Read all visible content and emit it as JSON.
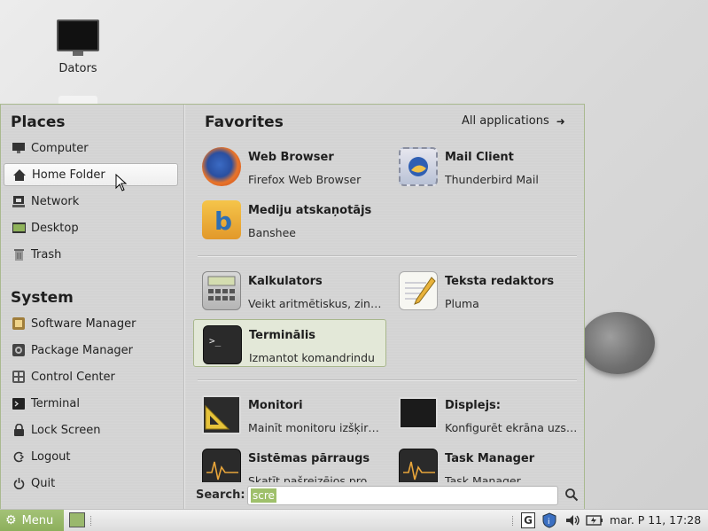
{
  "desktop": {
    "computer_label": "Dators"
  },
  "places": {
    "title": "Places",
    "items": [
      {
        "label": "Computer"
      },
      {
        "label": "Home Folder"
      },
      {
        "label": "Network"
      },
      {
        "label": "Desktop"
      },
      {
        "label": "Trash"
      }
    ]
  },
  "system": {
    "title": "System",
    "items": [
      {
        "label": "Software Manager"
      },
      {
        "label": "Package Manager"
      },
      {
        "label": "Control Center"
      },
      {
        "label": "Terminal"
      },
      {
        "label": "Lock Screen"
      },
      {
        "label": "Logout"
      },
      {
        "label": "Quit"
      }
    ]
  },
  "favorites": {
    "title": "Favorites",
    "all_apps_label": "All applications",
    "apps": [
      {
        "name": "Web Browser",
        "desc": "Firefox Web Browser"
      },
      {
        "name": "Mail Client",
        "desc": "Thunderbird Mail"
      },
      {
        "name": "Mediju atskaņotājs",
        "desc": "Banshee"
      },
      {
        "name": "Kalkulators",
        "desc": "Veikt aritmētiskus, zinā..."
      },
      {
        "name": "Teksta redaktors",
        "desc": "Pluma"
      },
      {
        "name": "Terminālis",
        "desc": "Izmantot komandrindu"
      },
      {
        "name": "Monitori",
        "desc": "Mainīt monitoru izšķirts..."
      },
      {
        "name": "Displejs:",
        "desc": "Konfigurēt ekrāna uzst..."
      },
      {
        "name": "Sistēmas pārraugs",
        "desc": "Skatīt pašreizējos proc..."
      },
      {
        "name": "Task Manager",
        "desc": "Task Manager"
      }
    ]
  },
  "search": {
    "label": "Search:",
    "value": "scre"
  },
  "taskbar": {
    "menu_label": "Menu",
    "clock": "mar. P  11, 17:28",
    "accent": "#94b464"
  }
}
